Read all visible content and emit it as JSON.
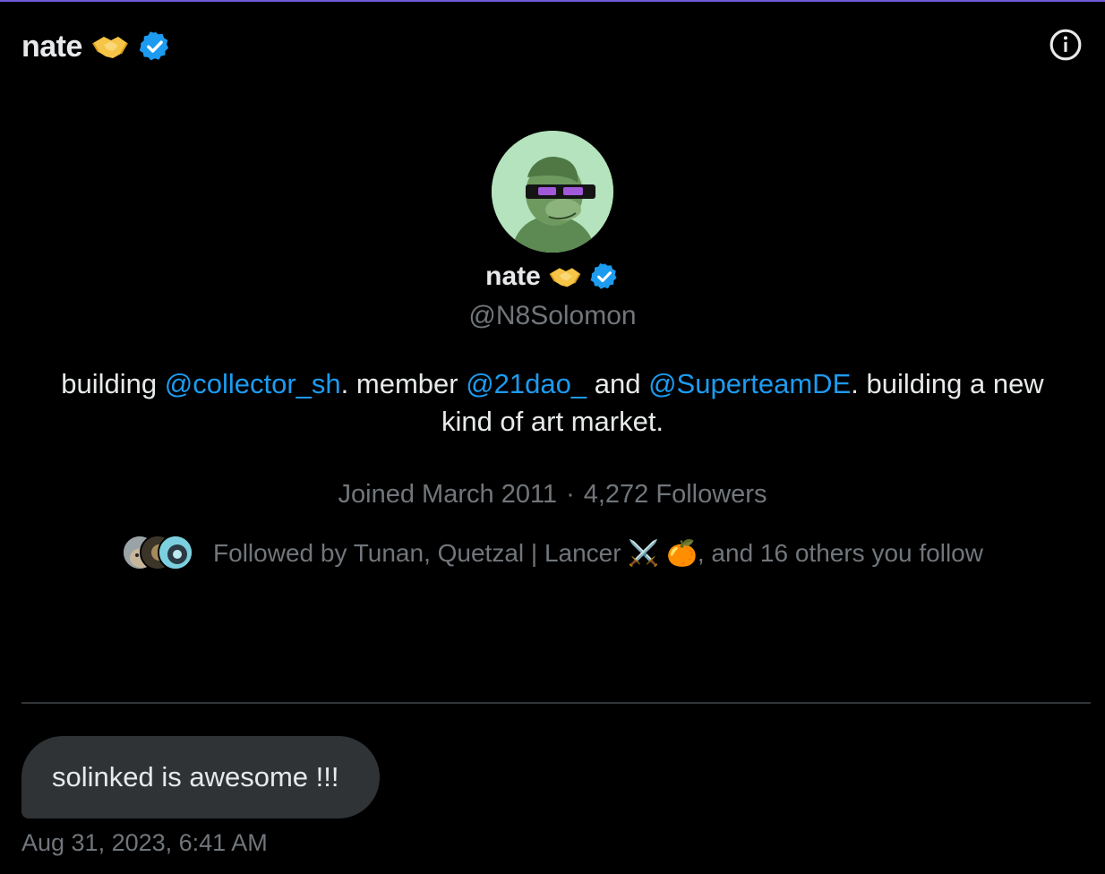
{
  "header": {
    "name": "nate",
    "emoji": "🤝",
    "verified_icon": "verified-badge-icon",
    "info_icon": "info-icon"
  },
  "profile": {
    "name": "nate",
    "emoji": "🤝",
    "handle": "@N8Solomon",
    "bio": {
      "t1": "building ",
      "m1": "@collector_sh",
      "t2": ". member ",
      "m2": "@21dao_",
      "t3": " and ",
      "m3": "@SuperteamDE",
      "t4": ". building a new kind of art market."
    },
    "joined": "Joined March 2011",
    "separator": "·",
    "followers": "4,272 Followers",
    "followed_by": {
      "prefix": "Followed by Tunan, Quetzal | Lancer ",
      "emoji1": "⚔️",
      "emoji2": "🍊",
      "suffix": ", and 16 others you follow"
    }
  },
  "message": {
    "text": "solinked is awesome !!!",
    "timestamp": "Aug 31, 2023, 6:41 AM"
  },
  "colors": {
    "background": "#000000",
    "accent": "#1d9bf0",
    "muted": "#71767b",
    "bubble": "#2f3336"
  }
}
